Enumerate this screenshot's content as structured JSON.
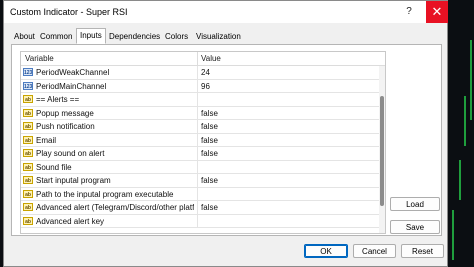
{
  "window": {
    "title": "Custom Indicator - Super RSI",
    "help_label": "?",
    "close_label": "✕"
  },
  "tabs": [
    {
      "label": "About"
    },
    {
      "label": "Common"
    },
    {
      "label": "Inputs"
    },
    {
      "label": "Dependencies"
    },
    {
      "label": "Colors"
    },
    {
      "label": "Visualization"
    }
  ],
  "active_tab": "Inputs",
  "grid": {
    "col_variable": "Variable",
    "col_value": "Value",
    "rows": [
      {
        "icon": "123",
        "name": "PeriodWeakChannel",
        "value": "24"
      },
      {
        "icon": "123",
        "name": "PeriodMainChannel",
        "value": "96"
      },
      {
        "icon": "ab",
        "name": "== Alerts ==",
        "value": ""
      },
      {
        "icon": "ab",
        "name": "Popup message",
        "value": "false"
      },
      {
        "icon": "ab",
        "name": "Push notification",
        "value": "false"
      },
      {
        "icon": "ab",
        "name": "Email",
        "value": "false"
      },
      {
        "icon": "ab",
        "name": "Play sound on alert",
        "value": "false"
      },
      {
        "icon": "ab",
        "name": "Sound file",
        "value": ""
      },
      {
        "icon": "ab",
        "name": "Start inputal program",
        "value": "false"
      },
      {
        "icon": "ab",
        "name": "Path to the inputal program executable",
        "value": ""
      },
      {
        "icon": "ab",
        "name": "Advanced alert (Telegram/Discord/other platfo...",
        "value": "false"
      },
      {
        "icon": "ab",
        "name": "Advanced alert key",
        "value": ""
      }
    ]
  },
  "buttons": {
    "load": "Load",
    "save": "Save",
    "ok": "OK",
    "cancel": "Cancel",
    "reset": "Reset"
  },
  "colors": {
    "close_button": "#e81123",
    "primary_border": "#0067c0",
    "chart_line": "#1f9e3d"
  }
}
